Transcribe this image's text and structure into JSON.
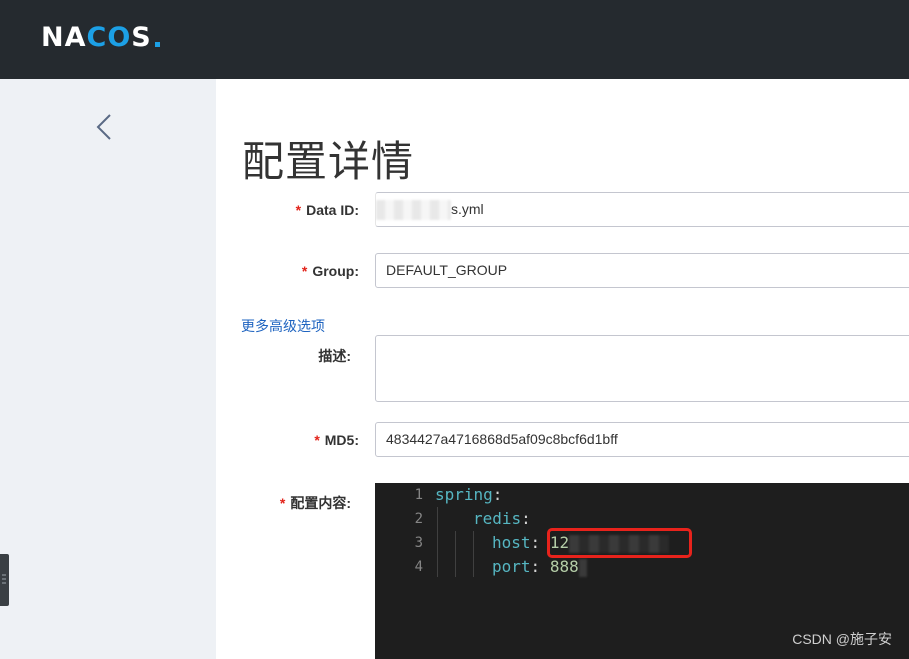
{
  "header": {
    "logo_text_a": "NA",
    "logo_text_c": "C",
    "logo_text_o": "O",
    "logo_text_s": "S"
  },
  "page": {
    "title": "配置详情"
  },
  "form": {
    "data_id": {
      "label": "Data ID:",
      "required": "*",
      "value_suffix": "s.yml"
    },
    "group": {
      "label": "Group:",
      "required": "*",
      "value": "DEFAULT_GROUP"
    },
    "advanced_link": "更多高级选项",
    "description": {
      "label": "描述:",
      "value": ""
    },
    "md5": {
      "label": "MD5:",
      "required": "*",
      "value": "4834427a4716868d5af09c8bcf6d1bff"
    },
    "content": {
      "label": "配置内容:",
      "required": "*"
    }
  },
  "editor": {
    "lines": [
      {
        "num": "1",
        "key": "spring",
        "punc": ":",
        "value": ""
      },
      {
        "num": "2",
        "key": "redis",
        "punc": ":",
        "value": ""
      },
      {
        "num": "3",
        "key": "host",
        "punc": ":",
        "value": "12"
      },
      {
        "num": "4",
        "key": "port",
        "punc": ":",
        "value": "888"
      }
    ]
  },
  "watermark": "CSDN @施子安",
  "colors": {
    "header_bg": "#252a2f",
    "brand_blue": "#1ca0e6",
    "link_blue": "#1f64c0",
    "required_red": "#e2231a",
    "highlight_red": "#e8231c",
    "editor_bg": "#1e1e1e"
  }
}
